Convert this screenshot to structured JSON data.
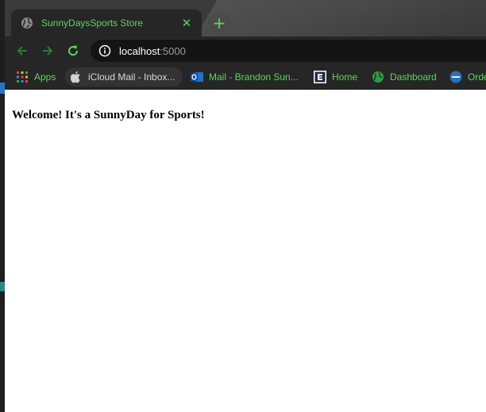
{
  "browser": {
    "tab": {
      "title": "SunnyDaysSports Store",
      "close_glyph": "✕",
      "favicon": "globe-icon"
    },
    "new_tab_glyph": "+",
    "omnibox": {
      "host": "localhost",
      "port": ":5000"
    },
    "bookmarks": [
      {
        "label": "Apps",
        "icon": "apps-grid-icon"
      },
      {
        "label": "iCloud Mail - Inbox...",
        "icon": "apple-icon"
      },
      {
        "label": "Mail - Brandon Sun...",
        "icon": "outlook-icon"
      },
      {
        "label": "Home",
        "icon": "e-icon"
      },
      {
        "label": "Dashboard",
        "icon": "globe-icon"
      },
      {
        "label": "Orde",
        "icon": "oth-icon"
      }
    ],
    "colors": {
      "accent_green": "#5cd65c",
      "chrome_dark": "#262626"
    }
  },
  "page": {
    "heading": "Welcome! It's a SunnyDay for Sports!"
  }
}
